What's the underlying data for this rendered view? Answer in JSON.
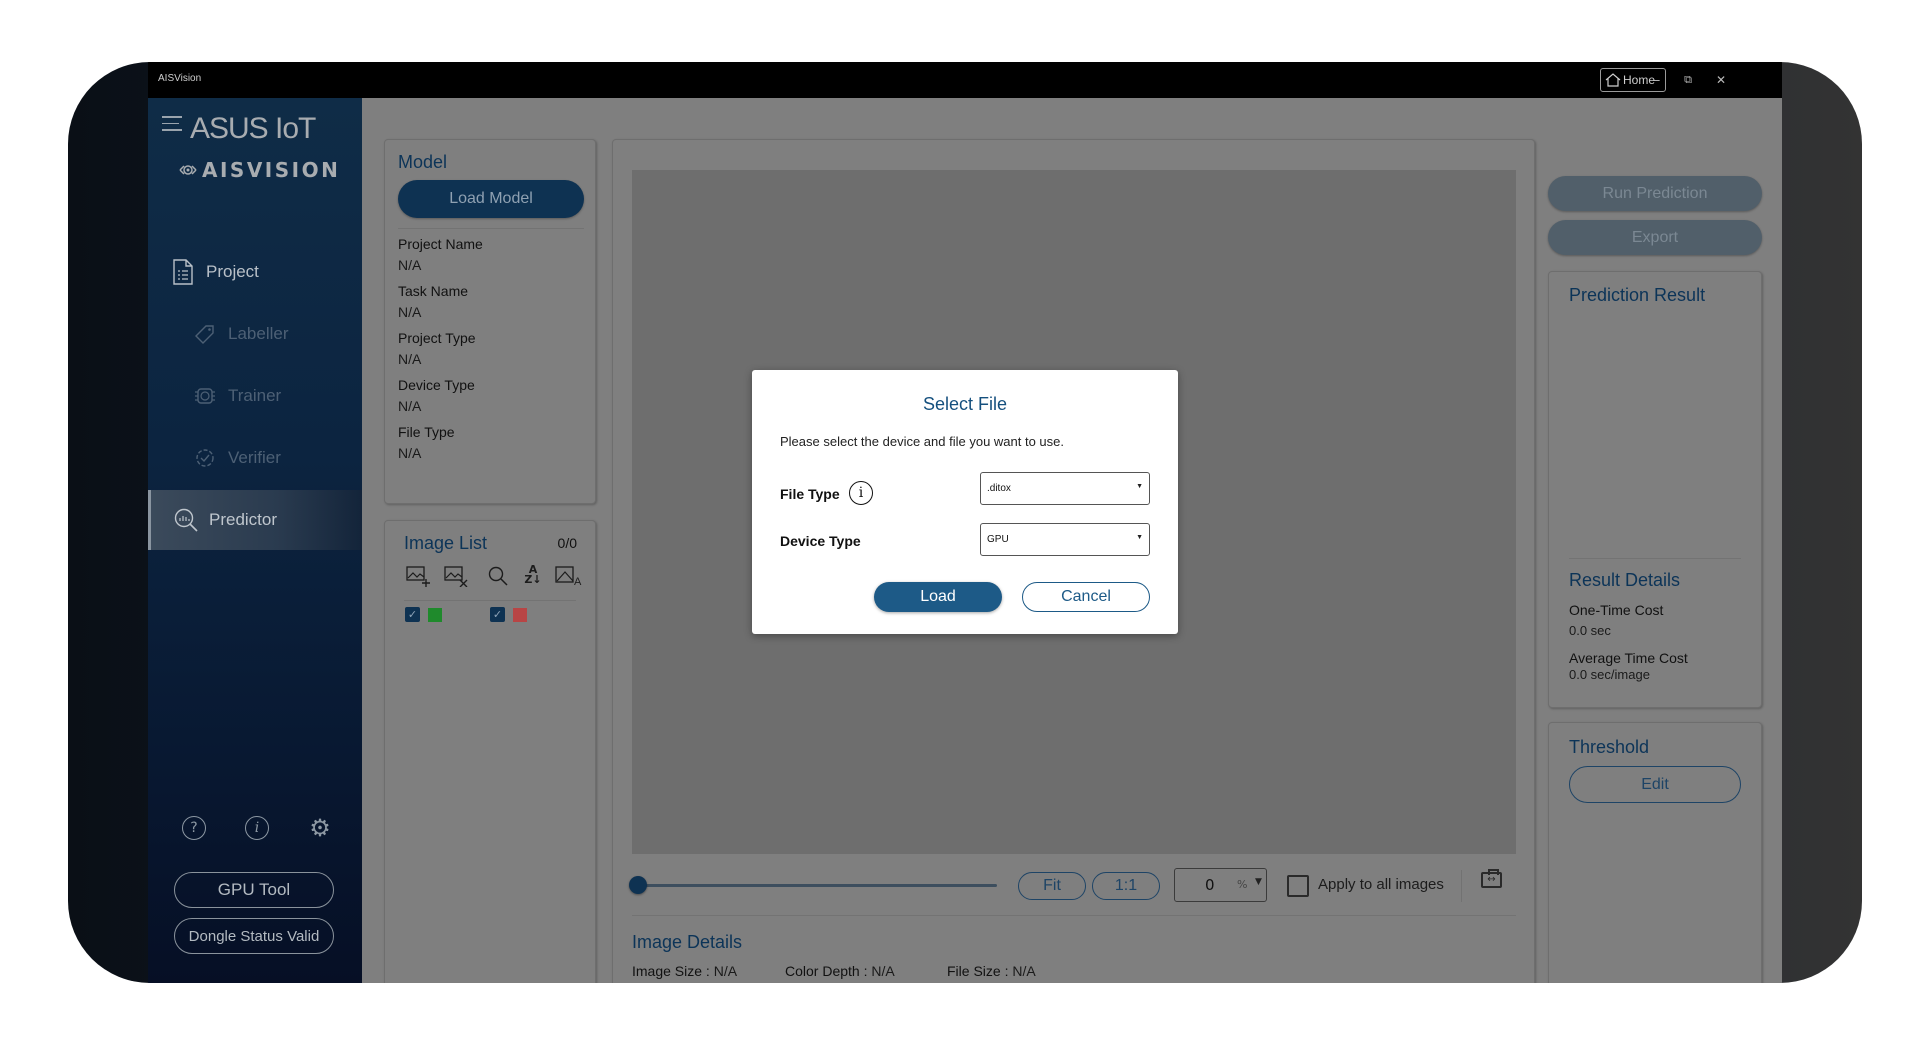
{
  "titlebar": {
    "app_name": "AISVision",
    "home_label": "Home",
    "minimize_glyph": "–",
    "restore_glyph": "⧉",
    "close_glyph": "✕"
  },
  "sidebar": {
    "logo_line1": "ASUS IoT",
    "logo_line2": "AISVISION",
    "items": [
      {
        "label": "Project",
        "icon": "document-list-icon",
        "state": "enabled"
      },
      {
        "label": "Labeller",
        "icon": "tag-icon",
        "state": "disabled"
      },
      {
        "label": "Trainer",
        "icon": "chip-icon",
        "state": "disabled"
      },
      {
        "label": "Verifier",
        "icon": "gear-check-icon",
        "state": "disabled"
      },
      {
        "label": "Predictor",
        "icon": "search-chart-icon",
        "state": "active"
      }
    ],
    "bottom_icons": {
      "help": "?",
      "info": "i",
      "settings": "⚙"
    },
    "gpu_tool_label": "GPU Tool",
    "dongle_status_label": "Dongle Status Valid"
  },
  "model_panel": {
    "title": "Model",
    "load_model_label": "Load Model",
    "fields": [
      {
        "label": "Project Name",
        "value": "N/A"
      },
      {
        "label": "Task Name",
        "value": "N/A"
      },
      {
        "label": "Project Type",
        "value": "N/A"
      },
      {
        "label": "Device Type",
        "value": "N/A"
      },
      {
        "label": "File Type",
        "value": "N/A"
      }
    ]
  },
  "image_list": {
    "title": "Image List",
    "count": "0/0",
    "toolbar_icons": [
      "add-image-icon",
      "remove-image-icon",
      "search-icon",
      "sort-az-icon",
      "image-label-icon"
    ],
    "filters": [
      {
        "checked": true,
        "color": "#1f8a2c"
      },
      {
        "checked": true,
        "color": "#b84545"
      }
    ]
  },
  "viewer": {
    "slider_value": 0,
    "fit_label": "Fit",
    "one_to_one_label": "1:1",
    "zoom_value": "0",
    "zoom_unit": "%",
    "apply_all_label": "Apply to all images",
    "apply_all_checked": false,
    "details_title": "Image Details",
    "details": [
      {
        "label": "Image Size",
        "value": "N/A"
      },
      {
        "label": "Color Depth",
        "value": "N/A"
      },
      {
        "label": "File Size",
        "value": "N/A"
      }
    ]
  },
  "right_panel": {
    "run_prediction_label": "Run Prediction",
    "export_label": "Export",
    "prediction_result_title": "Prediction Result",
    "result_details_title": "Result Details",
    "one_time_cost_label": "One-Time Cost",
    "one_time_cost_value": "0.0 sec",
    "avg_time_cost_label": "Average Time Cost",
    "avg_time_cost_value": "0.0 sec/image",
    "threshold_title": "Threshold",
    "edit_label": "Edit"
  },
  "dialog": {
    "title": "Select File",
    "description": "Please select the device and file you want to use.",
    "file_type_label": "File Type",
    "file_type_value": ".ditox",
    "device_type_label": "Device Type",
    "device_type_value": "GPU",
    "load_label": "Load",
    "cancel_label": "Cancel"
  },
  "colors": {
    "brand_dark": "#0e3252",
    "dialog_accent": "#1d5a87",
    "overlay_gray": "#7f7f7f"
  }
}
